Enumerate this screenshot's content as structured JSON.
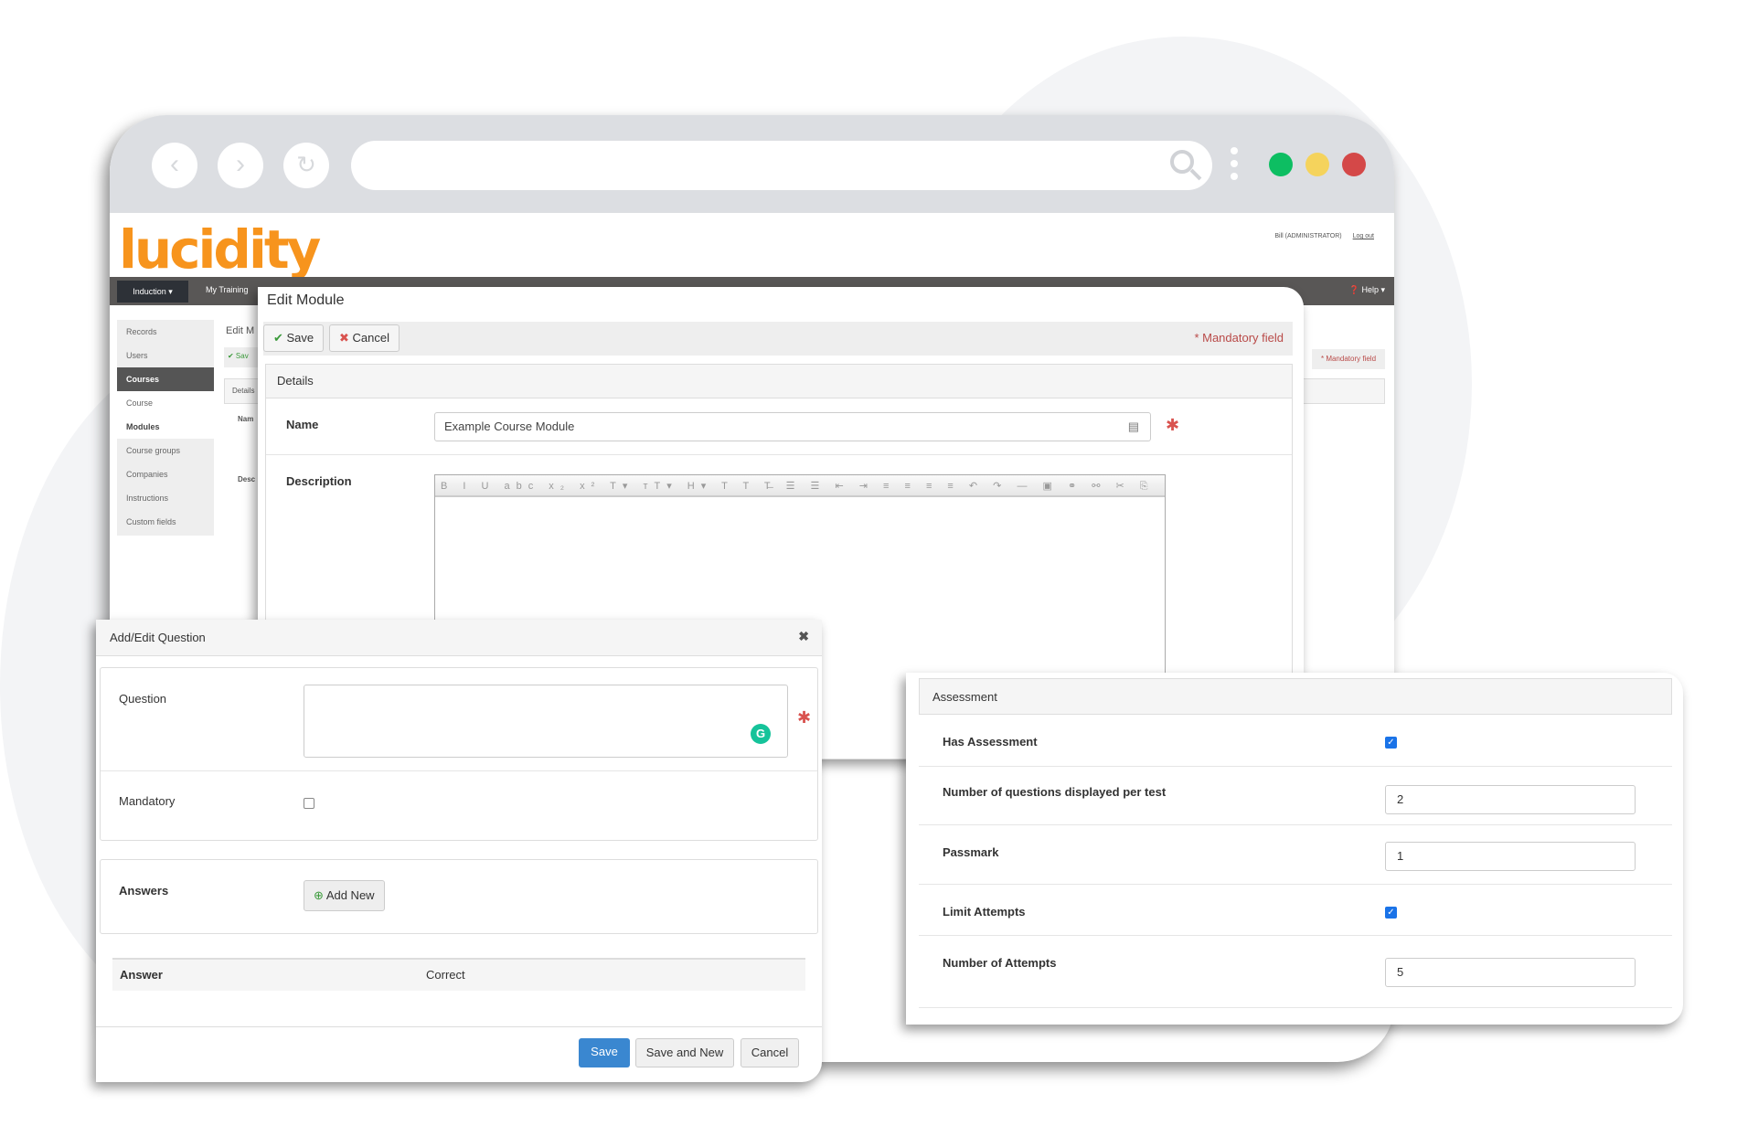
{
  "browser": {
    "back_icon": "chevron-left-icon",
    "forward_icon": "chevron-right-icon",
    "reload_icon": "reload-icon",
    "search_icon": "search-icon",
    "window_controls": {
      "green": "#0dbe62",
      "yellow": "#f5d35c",
      "red": "#d44848"
    }
  },
  "app": {
    "logo": "lucidity",
    "brand_color": "#f7941d",
    "user": "Bill (ADMINISTRATOR)",
    "logout": "Log out",
    "nav": {
      "induction": "Induction ▾",
      "my_training": "My Training",
      "help": "❓ Help ▾"
    },
    "sidebar": [
      {
        "label": "Records"
      },
      {
        "label": "Users"
      },
      {
        "label": "Courses"
      },
      {
        "label": "Course"
      },
      {
        "label": "Modules"
      },
      {
        "label": "Course groups"
      },
      {
        "label": "Companies"
      },
      {
        "label": "Instructions"
      },
      {
        "label": "Custom fields"
      }
    ],
    "bg_title": "Edit M",
    "bg_save": "✔ Sav",
    "bg_details": "Details",
    "bg_name": "Nam",
    "bg_desc": "Desc",
    "bg_mandatory": "* Mandatory field"
  },
  "edit_module": {
    "title": "Edit Module",
    "save": "Save",
    "cancel": "Cancel",
    "mandatory_note": "* Mandatory field",
    "section": "Details",
    "name_label": "Name",
    "name_value": "Example Course Module",
    "description_label": "Description",
    "editor_toolbar": "B I U abc x₂ x² T▾ тT▾ H▾ T T T̶ ☰ ☰ ⇤ ⇥ ≡ ≡ ≡ ≡ ↶ ↷ ― ▣ ⚭ ⚯ ✂ ⎘ 📋 📋 🖶 ⎙"
  },
  "question_dialog": {
    "title": "Add/Edit Question",
    "close": "✖",
    "question_label": "Question",
    "question_value": "",
    "mandatory_label": "Mandatory",
    "mandatory_checked": false,
    "answers_label": "Answers",
    "add_new": "Add New",
    "table_headers": [
      "Answer",
      "Correct"
    ],
    "save": "Save",
    "save_and_new": "Save and New",
    "cancel": "Cancel"
  },
  "assessment": {
    "title": "Assessment",
    "has_assessment_label": "Has Assessment",
    "has_assessment": true,
    "questions_per_test_label": "Number of questions displayed per test",
    "questions_per_test": "2",
    "passmark_label": "Passmark",
    "passmark": "1",
    "limit_attempts_label": "Limit Attempts",
    "limit_attempts": true,
    "attempts_label": "Number of Attempts",
    "attempts": "5"
  }
}
